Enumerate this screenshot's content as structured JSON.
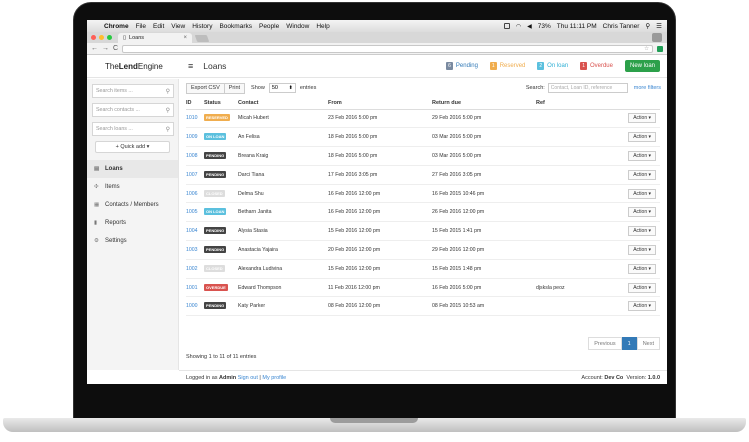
{
  "menubar": {
    "app": "Chrome",
    "items": [
      "File",
      "Edit",
      "View",
      "History",
      "Bookmarks",
      "People",
      "Window",
      "Help"
    ],
    "battery": "73%",
    "clock": "Thu 11:11 PM",
    "user": "Chris Tanner"
  },
  "browser": {
    "tab_title": "Loans",
    "address": ""
  },
  "app": {
    "brand_pre": "The",
    "brand_bold": "Lend",
    "brand_post": "Engine",
    "page_title": "Loans",
    "stats": [
      {
        "num": "6",
        "label": "Pending",
        "color": "#7a8aa0",
        "text_color": "#337ab7"
      },
      {
        "num": "1",
        "label": "Reserved",
        "color": "#f0ad4e",
        "text_color": "#f0ad4e"
      },
      {
        "num": "2",
        "label": "On loan",
        "color": "#5bc0de",
        "text_color": "#31b0d5"
      },
      {
        "num": "1",
        "label": "Overdue",
        "color": "#d9534f",
        "text_color": "#d9534f"
      }
    ],
    "new_loan": "New loan"
  },
  "sidebar": {
    "search_items": "Search items ...",
    "search_contacts": "Search contacts ...",
    "search_loans": "Search loans ...",
    "quick_add": "+ Quick add ▾",
    "nav": [
      {
        "label": "Loans",
        "icon": "loans-icon",
        "glyph": "▤",
        "active": true
      },
      {
        "label": "Items",
        "icon": "items-icon",
        "glyph": "✣",
        "active": false
      },
      {
        "label": "Contacts / Members",
        "icon": "contacts-icon",
        "glyph": "▦",
        "active": false
      },
      {
        "label": "Reports",
        "icon": "reports-icon",
        "glyph": "▮",
        "active": false
      },
      {
        "label": "Settings",
        "icon": "settings-icon",
        "glyph": "⚙",
        "active": false
      }
    ]
  },
  "toolbar": {
    "export_csv": "Export CSV",
    "print": "Print",
    "show_label": "Show",
    "page_size": "50",
    "entries_label": "entries",
    "search_label": "Search:",
    "search_placeholder": "Contact, Loan ID, reference",
    "more_filters": "more filters"
  },
  "table": {
    "headers": [
      "ID",
      "Status",
      "Contact",
      "From",
      "Return due",
      "Ref",
      ""
    ],
    "action_label": "Action ▾",
    "rows": [
      {
        "id": "1010",
        "status": "RESERVED",
        "status_color": "#f0ad4e",
        "contact": "Micah Hubert",
        "from": "23 Feb 2016 5:00 pm",
        "due": "29 Feb 2016 5:00 pm",
        "ref": ""
      },
      {
        "id": "1009",
        "status": "ON LOAN",
        "status_color": "#5bc0de",
        "contact": "An Felisa",
        "from": "18 Feb 2016 5:00 pm",
        "due": "03 Mar 2016 5:00 pm",
        "ref": ""
      },
      {
        "id": "1008",
        "status": "PENDING",
        "status_color": "#444444",
        "contact": "Breana Kraig",
        "from": "18 Feb 2016 5:00 pm",
        "due": "03 Mar 2016 5:00 pm",
        "ref": ""
      },
      {
        "id": "1007",
        "status": "PENDING",
        "status_color": "#444444",
        "contact": "Darci Tiana",
        "from": "17 Feb 2016 3:05 pm",
        "due": "27 Feb 2016 3:05 pm",
        "ref": ""
      },
      {
        "id": "1006",
        "status": "CLOSED",
        "status_color": "#dddddd",
        "contact": "Delma Shu",
        "from": "16 Feb 2016 12:00 pm",
        "due": "16 Feb 2015 10:46 pm",
        "ref": ""
      },
      {
        "id": "1005",
        "status": "ON LOAN",
        "status_color": "#5bc0de",
        "contact": "Betharn Janita",
        "from": "16 Feb 2016 12:00 pm",
        "due": "26 Feb 2016 12:00 pm",
        "ref": ""
      },
      {
        "id": "1004",
        "status": "PENDING",
        "status_color": "#444444",
        "contact": "Alysia Stasia",
        "from": "15 Feb 2016 12:00 pm",
        "due": "15 Feb 2015 1:41 pm",
        "ref": ""
      },
      {
        "id": "1003",
        "status": "PENDING",
        "status_color": "#444444",
        "contact": "Anastacia Yajaira",
        "from": "20 Feb 2016 12:00 pm",
        "due": "29 Feb 2016 12:00 pm",
        "ref": ""
      },
      {
        "id": "1002",
        "status": "CLOSED",
        "status_color": "#dddddd",
        "contact": "Alexandra Ludivina",
        "from": "15 Feb 2016 12:00 pm",
        "due": "15 Feb 2015 1:48 pm",
        "ref": ""
      },
      {
        "id": "1001",
        "status": "OVERDUE",
        "status_color": "#d9534f",
        "contact": "Edward Thompson",
        "from": "11 Feb 2016 12:00 pm",
        "due": "16 Feb 2016 5:00 pm",
        "ref": "djsksla peoz"
      },
      {
        "id": "1000",
        "status": "PENDING",
        "status_color": "#444444",
        "contact": "Katy Parker",
        "from": "08 Feb 2016 12:00 pm",
        "due": "08 Feb 2015 10:53 am",
        "ref": ""
      }
    ]
  },
  "pagination": {
    "showing": "Showing 1 to 11 of 11 entries",
    "previous": "Previous",
    "current": "1",
    "next": "Next"
  },
  "footer": {
    "logged_in_pre": "Logged in as",
    "user": "Admin",
    "sign_out": "Sign out",
    "sep": "|",
    "my_profile": "My profile",
    "account_label": "Account:",
    "account": "Dev Co",
    "version_label": "Version:",
    "version": "1.0.0"
  }
}
